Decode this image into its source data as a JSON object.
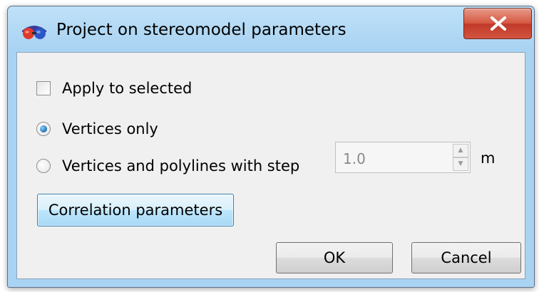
{
  "dialog": {
    "title": "Project on stereomodel parameters",
    "app_icon": "stereo-glasses-icon",
    "close_icon": "close-x-icon"
  },
  "options": {
    "apply_to_selected": {
      "label": "Apply to selected",
      "checked": false
    },
    "vertices_only": {
      "label": "Vertices only",
      "selected": true
    },
    "vertices_and_polylines": {
      "label": "Vertices and polylines with step",
      "selected": false
    }
  },
  "step": {
    "value": "1.0",
    "unit": "m",
    "enabled": false
  },
  "buttons": {
    "correlation": "Correlation parameters",
    "ok": "OK",
    "cancel": "Cancel"
  },
  "colors": {
    "title_bar": "#a9d3f2",
    "close_button": "#c1382a",
    "client_background": "#f0f0f0"
  }
}
